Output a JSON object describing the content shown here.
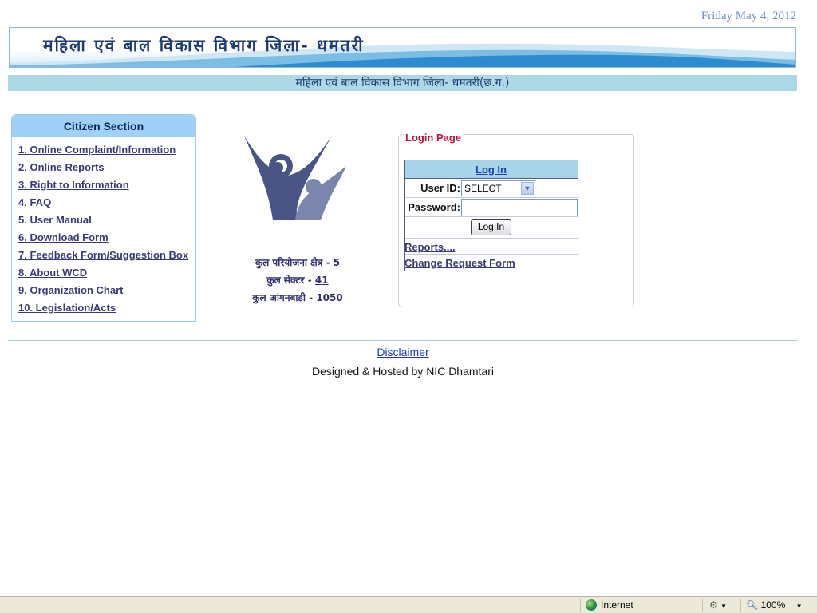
{
  "header": {
    "date": "Friday May 4, 2012",
    "banner_title": "महिला एवं बाल विकास विभाग जिला- धमतरी",
    "subtitle": "महिला एवं बाल विकास विभाग जिला- धमतरी(छ.ग.)"
  },
  "citizen_section": {
    "title": "Citizen Section",
    "items": [
      {
        "label": "1. Online Complaint/Information",
        "link": true
      },
      {
        "label": "2. Online Reports",
        "link": true
      },
      {
        "label": "3. Right to Information",
        "link": true
      },
      {
        "label": "4. FAQ",
        "link": false
      },
      {
        "label": "5. User Manual",
        "link": false
      },
      {
        "label": "6. Download Form",
        "link": true
      },
      {
        "label": "7. Feedback Form/Suggestion Box",
        "link": true
      },
      {
        "label": "8. About WCD",
        "link": true
      },
      {
        "label": "9. Organization Chart",
        "link": true
      },
      {
        "label": "10. Legislation/Acts",
        "link": true
      }
    ]
  },
  "stats": [
    {
      "label": "कुल परियोजना क्षेत्र -",
      "value": "5"
    },
    {
      "label": "कुल सेक्टर -",
      "value": "41"
    },
    {
      "label": "कुल आंगनबाडी -",
      "value": "1050"
    }
  ],
  "login": {
    "legend": "Login Page",
    "header_link": "Log In",
    "user_id_label": "User ID:",
    "user_id_selected": "SELECT",
    "password_label": "Password:",
    "password_value": "",
    "button": "Log In",
    "links": [
      "Reports....",
      "Change Request Form"
    ]
  },
  "footer": {
    "disclaimer": "Disclaimer",
    "credit": "Designed & Hosted by NIC Dhamtari"
  },
  "statusbar": {
    "zone": "Internet",
    "zoom": "100%"
  },
  "colors": {
    "banner_text": "#1f3b73",
    "subbar_bg": "#add8e6",
    "citizen_head_bg": "#9fd1f7",
    "login_legend": "#c0123c",
    "link": "#3a3a7a"
  }
}
